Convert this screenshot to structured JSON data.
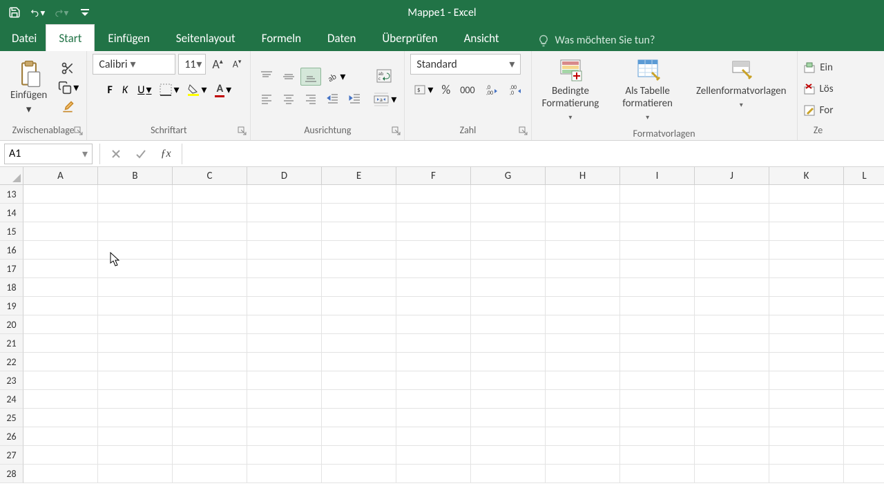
{
  "app": {
    "title": "Mappe1 - Excel"
  },
  "tabs": {
    "file": "Datei",
    "home": "Start",
    "insert": "Einfügen",
    "pagelayout": "Seitenlayout",
    "formulas": "Formeln",
    "data": "Daten",
    "review": "Überprüfen",
    "view": "Ansicht",
    "tellme": "Was möchten Sie tun?"
  },
  "ribbon": {
    "clipboard": {
      "label": "Zwischenablage",
      "paste": "Einfügen"
    },
    "font": {
      "label": "Schriftart",
      "name": "Calibri",
      "size": "11",
      "bold": "F",
      "italic": "K",
      "underline": "U"
    },
    "alignment": {
      "label": "Ausrichtung"
    },
    "number": {
      "label": "Zahl",
      "format": "Standard"
    },
    "styles": {
      "label": "Formatvorlagen",
      "cond": "Bedingte\nFormatierung",
      "table": "Als Tabelle\nformatieren",
      "cell": "Zellenformatvorlagen"
    },
    "cells": {
      "label": "Ze",
      "insert": "Ein",
      "delete": "Lös",
      "format": "For"
    }
  },
  "namebox": "A1",
  "columns": [
    "A",
    "B",
    "C",
    "D",
    "E",
    "F",
    "G",
    "H",
    "I",
    "J",
    "K",
    "L"
  ],
  "rows": [
    "13",
    "14",
    "15",
    "16",
    "17",
    "18",
    "19",
    "20",
    "21",
    "22",
    "23",
    "24",
    "25",
    "26",
    "27",
    "28"
  ]
}
